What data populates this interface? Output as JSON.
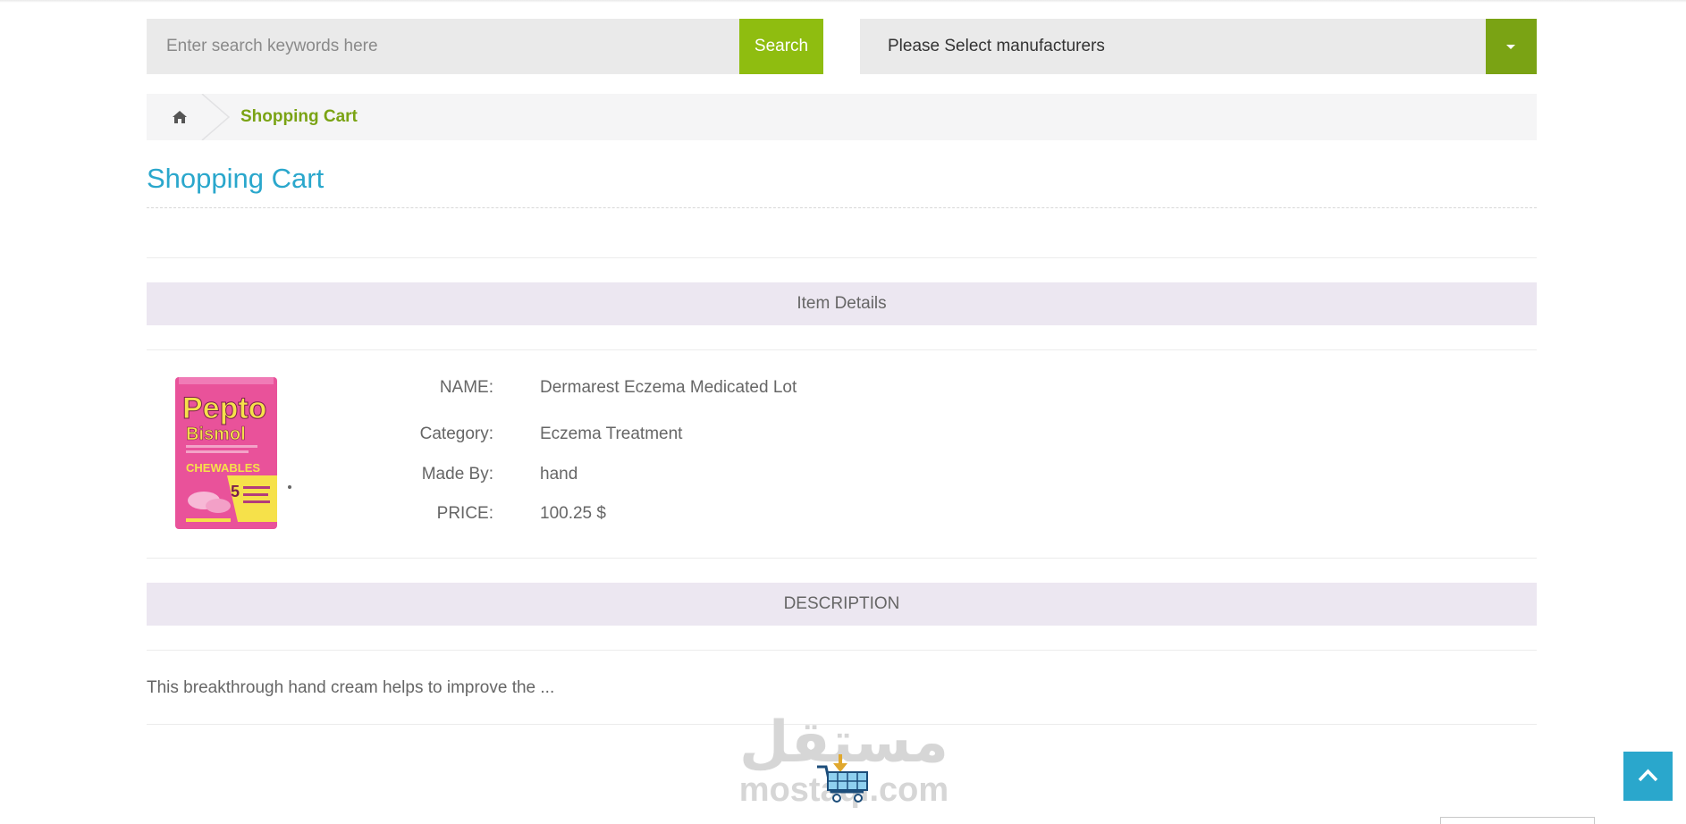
{
  "search": {
    "placeholder": "Enter search keywords here",
    "button_label": "Search"
  },
  "manufacturer_select": {
    "selected": "Please Select manufacturers"
  },
  "breadcrumb": {
    "current": "Shopping Cart"
  },
  "page": {
    "title": "Shopping Cart"
  },
  "sections": {
    "item_details": "Item Details",
    "description": "DESCRIPTION"
  },
  "product": {
    "fields": [
      {
        "label": "NAME:",
        "value": "Dermarest Eczema Medicated Lot"
      },
      {
        "label": "Category:",
        "value": "Eczema Treatment"
      },
      {
        "label": "Made By:",
        "value": "hand"
      },
      {
        "label": "PRICE:",
        "value": "100.25 $"
      }
    ],
    "description": "This breakthrough hand cream helps to improve the ..."
  },
  "watermark": {
    "arabic": "مستقل",
    "latin": "mostaql.com"
  },
  "colors": {
    "accent_green": "#8fbd10",
    "dark_green": "#7aa314",
    "title_blue": "#2aa7cc",
    "section_bar": "#ece7f1"
  },
  "icons": {
    "home": "home-icon",
    "caret": "caret-down-icon",
    "scroll_top": "chevron-up-icon",
    "cart": "shopping-cart-icon"
  }
}
